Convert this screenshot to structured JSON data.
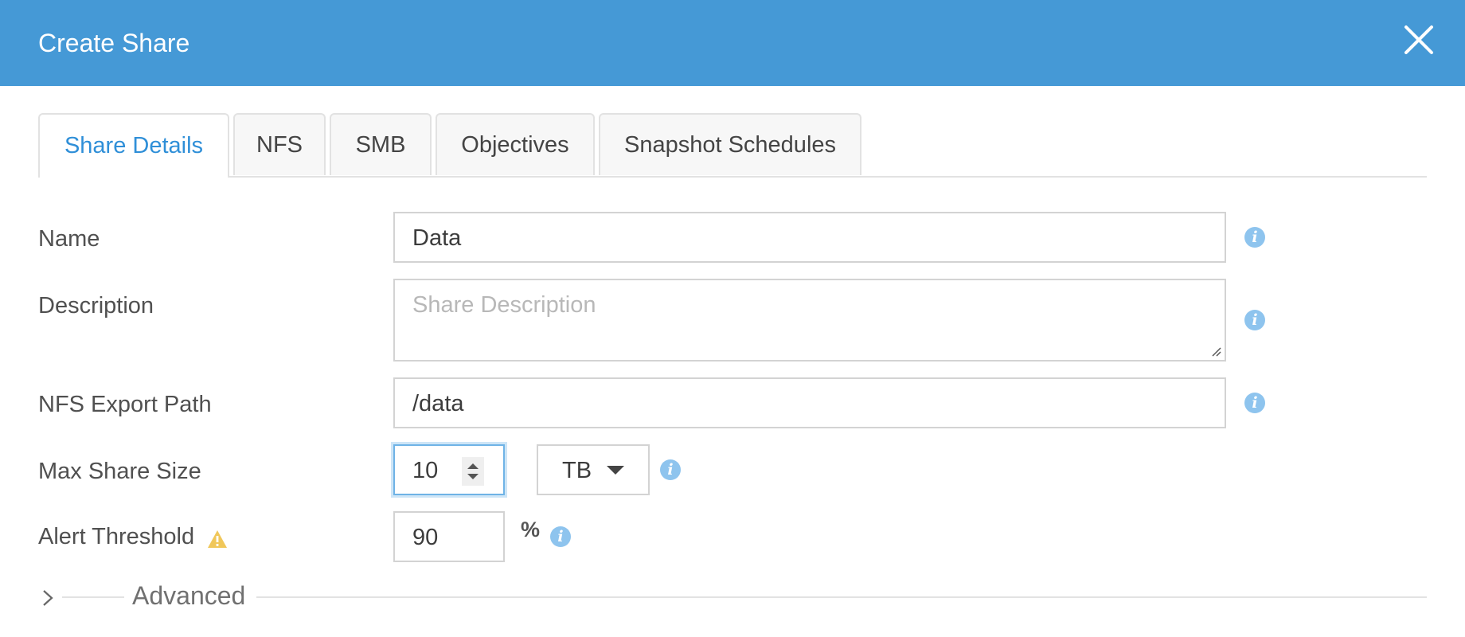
{
  "dialog": {
    "title": "Create Share",
    "close_icon": "close-icon",
    "header_color": "#4599d6"
  },
  "tabs": [
    {
      "label": "Share Details",
      "active": true
    },
    {
      "label": "NFS",
      "active": false
    },
    {
      "label": "SMB",
      "active": false
    },
    {
      "label": "Objectives",
      "active": false
    },
    {
      "label": "Snapshot Schedules",
      "active": false
    }
  ],
  "form": {
    "name": {
      "label": "Name",
      "value": "Data"
    },
    "description": {
      "label": "Description",
      "value": "",
      "placeholder": "Share Description"
    },
    "nfs_export_path": {
      "label": "NFS Export Path",
      "value": "/data"
    },
    "max_share_size": {
      "label": "Max Share Size",
      "value": "10",
      "unit": "TB"
    },
    "alert_threshold": {
      "label": "Alert Threshold",
      "value": "90",
      "unit": "%",
      "warning_icon": "warning-icon"
    }
  },
  "advanced": {
    "label": "Advanced",
    "expand_icon": "chevron-right-icon"
  },
  "colors": {
    "accent": "#2f8fd8",
    "info_icon": "#8ec4ee",
    "warning": "#f0c75a"
  }
}
